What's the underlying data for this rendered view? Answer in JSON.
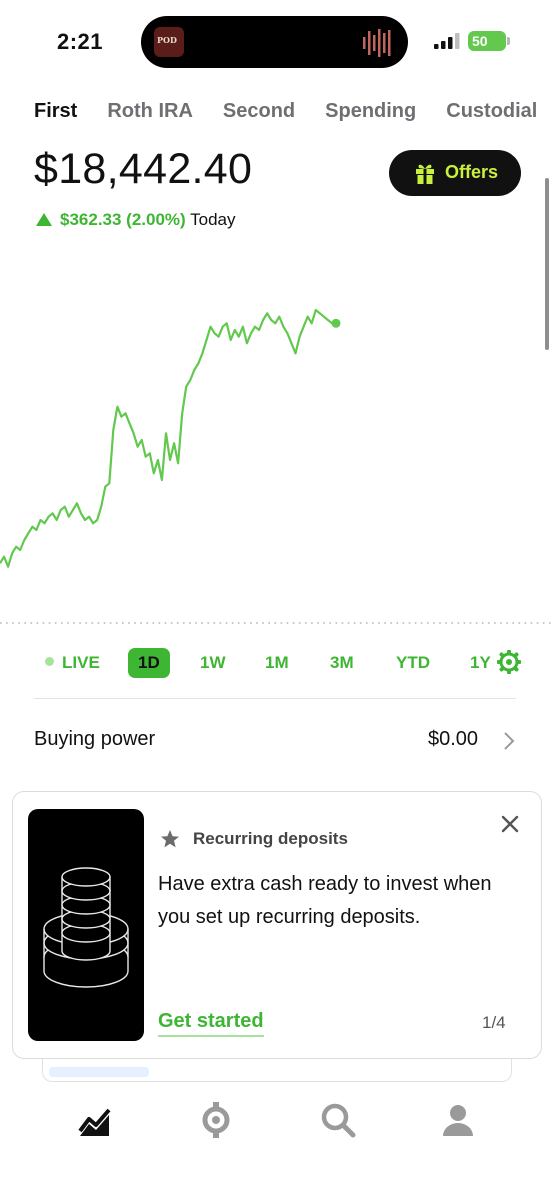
{
  "status_bar": {
    "time": "2:21",
    "battery": "50",
    "now_playing_art_text": "POD"
  },
  "tabs": [
    {
      "label": "First",
      "active": true
    },
    {
      "label": "Roth IRA",
      "active": false
    },
    {
      "label": "Second",
      "active": false
    },
    {
      "label": "Spending",
      "active": false
    },
    {
      "label": "Custodial",
      "active": false
    }
  ],
  "portfolio": {
    "value": "$18,442.40",
    "change": "$362.33 (2.00%)",
    "change_period": "Today",
    "direction": "up"
  },
  "offers_button": {
    "label": "Offers",
    "icon": "gift-icon"
  },
  "chart_data": {
    "type": "line",
    "title": "",
    "xlabel": "",
    "ylabel": "",
    "x": [
      0,
      1,
      2,
      3,
      4,
      5,
      6,
      7,
      8,
      9,
      10,
      11,
      12,
      13,
      14,
      15,
      16,
      17,
      18,
      19,
      20,
      21,
      22,
      23,
      24,
      25,
      26,
      27,
      28,
      29,
      30,
      31,
      32,
      33,
      34,
      35,
      36,
      37,
      38,
      39,
      40,
      41,
      42,
      43,
      44,
      45,
      46,
      47,
      48,
      49,
      50,
      51,
      52,
      53,
      54,
      55,
      56,
      57,
      58,
      59,
      60,
      61,
      62,
      63,
      64,
      65,
      66,
      67,
      68,
      69,
      70,
      71,
      72,
      73,
      74,
      75,
      76,
      77,
      78,
      79,
      80,
      81,
      82,
      83
    ],
    "values": [
      18.05,
      18.07,
      18.04,
      18.08,
      18.1,
      18.09,
      18.12,
      18.14,
      18.16,
      18.15,
      18.18,
      18.17,
      18.19,
      18.2,
      18.18,
      18.21,
      18.22,
      18.19,
      18.21,
      18.23,
      18.2,
      18.18,
      18.19,
      18.17,
      18.18,
      18.22,
      18.28,
      18.29,
      18.45,
      18.52,
      18.49,
      18.5,
      18.47,
      18.44,
      18.4,
      18.42,
      18.37,
      18.38,
      18.32,
      18.36,
      18.3,
      18.44,
      18.36,
      18.41,
      18.35,
      18.5,
      18.58,
      18.6,
      18.63,
      18.65,
      18.68,
      18.72,
      18.76,
      18.74,
      18.73,
      18.76,
      18.77,
      18.72,
      18.75,
      18.73,
      18.76,
      18.71,
      18.74,
      18.76,
      18.75,
      18.78,
      18.8,
      18.78,
      18.77,
      18.79,
      18.76,
      18.74,
      18.71,
      18.68,
      18.73,
      18.76,
      18.79,
      18.77,
      18.81,
      18.8,
      18.79,
      18.78,
      18.77,
      18.77
    ],
    "ylim": [
      18.0,
      18.9
    ],
    "baseline": 18.08,
    "line_color": "#62c84e",
    "grid": false
  },
  "ranges": [
    {
      "label": "LIVE",
      "active": false
    },
    {
      "label": "1D",
      "active": true
    },
    {
      "label": "1W",
      "active": false
    },
    {
      "label": "1M",
      "active": false
    },
    {
      "label": "3M",
      "active": false
    },
    {
      "label": "YTD",
      "active": false
    },
    {
      "label": "1Y",
      "active": false
    }
  ],
  "buying_power": {
    "label": "Buying power",
    "value": "$0.00"
  },
  "card": {
    "title": "Recurring deposits",
    "body": "Have extra cash ready to invest when you set up recurring deposits.",
    "cta": "Get started",
    "page": "1/4"
  },
  "nav": [
    "investing-icon",
    "crypto-icon",
    "search-icon",
    "account-icon"
  ],
  "colors": {
    "accent": "#3fb534",
    "accent_light": "#c8f03c",
    "text": "#111111"
  }
}
